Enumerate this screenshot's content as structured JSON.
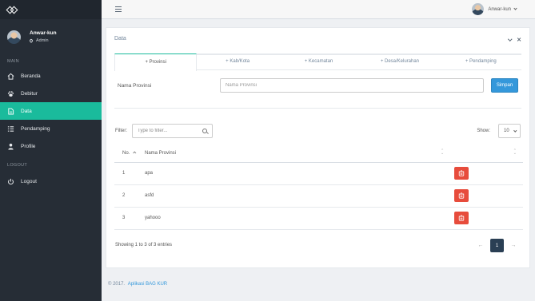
{
  "sidebar": {
    "user": {
      "name": "Anwar-kun",
      "role": "Admin"
    },
    "section_main": "MAIN",
    "items": [
      {
        "label": "Beranda",
        "icon": "home-icon"
      },
      {
        "label": "Debitur",
        "icon": "paw-icon"
      },
      {
        "label": "Data",
        "icon": "file-icon"
      },
      {
        "label": "Pendamping",
        "icon": "list-icon"
      },
      {
        "label": "Profile",
        "icon": "user-icon"
      }
    ],
    "section_logout": "LOGOUT",
    "logout_label": "Logout",
    "active_color": "#1abb9c"
  },
  "topnav": {
    "user_name": "Anwar-kun"
  },
  "panel": {
    "title": "Data",
    "tabs": [
      "+ Provinsi",
      "+ Kab/Kota",
      "+ Kecamatan",
      "+ Desa/Kelurahan",
      "+ Pendamping"
    ],
    "form": {
      "label": "Nama Provinsi",
      "placeholder": "Nama Provinsi",
      "save_label": "Simpan"
    },
    "filter": {
      "label": "Filter:",
      "placeholder": "Type to filter..."
    },
    "show": {
      "label": "Show:",
      "value": "10"
    },
    "table": {
      "headers": [
        "No.",
        "Nama Provinsi"
      ],
      "rows": [
        {
          "no": "1",
          "name": "apa"
        },
        {
          "no": "2",
          "name": "asfd"
        },
        {
          "no": "3",
          "name": "yahooo"
        }
      ]
    },
    "info": "Showing 1 to 3 of 3 entries",
    "pagination": {
      "prev": "←",
      "current": "1",
      "next": "→"
    }
  },
  "footer": {
    "text": "© 2017.",
    "link": "Aplikasi BAG KUR"
  },
  "colors": {
    "sidebar": "#262d36",
    "accent": "#1abb9c",
    "primary": "#3498db",
    "danger": "#e74c3c"
  }
}
